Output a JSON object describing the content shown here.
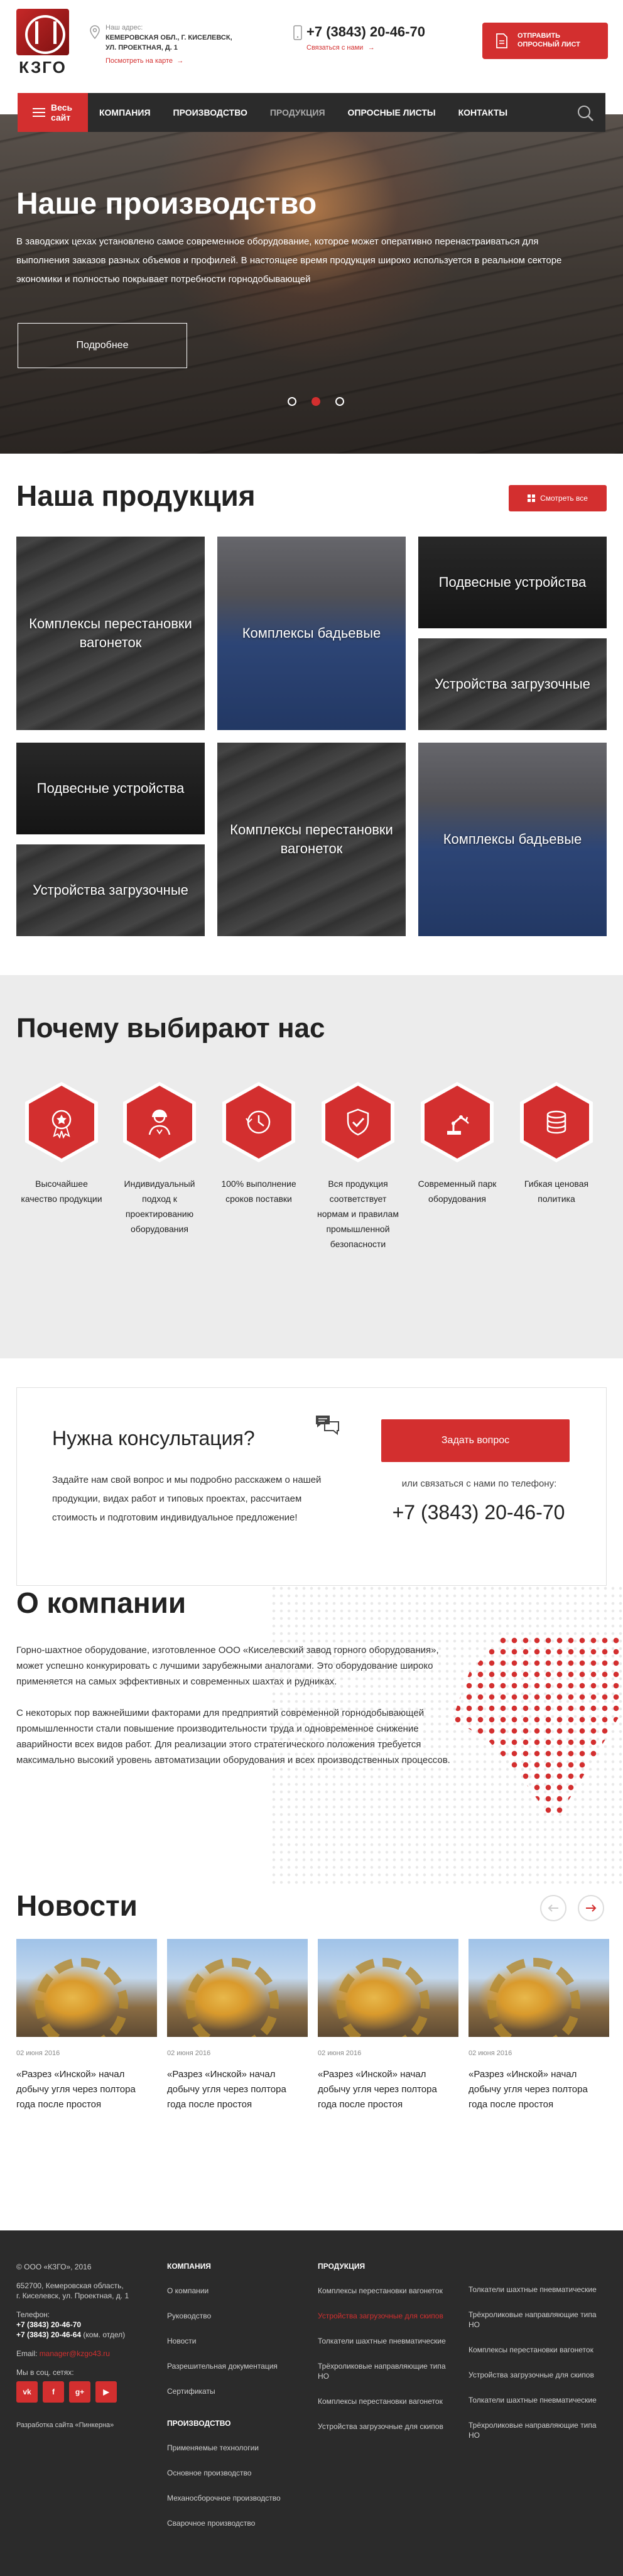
{
  "header": {
    "logo_text": "КЗГО",
    "address_label": "Наш адрес:",
    "address_line1": "Кемеровская обл., г. Киселевск,",
    "address_line2": "ул. Проектная, д. 1",
    "map_link": "Посмотреть на карте",
    "phone": "+7 (3843) 20-46-70",
    "contact_link": "Связаться с нами",
    "survey_btn_line1": "ОТПРАВИТЬ",
    "survey_btn_line2": "ОПРОСНЫЙ ЛИСТ"
  },
  "nav": {
    "all_site": "Весь сайт",
    "items": [
      "Компания",
      "Производство",
      "Продукция",
      "Опросные листы",
      "Контакты"
    ],
    "active": "Продукция"
  },
  "hero": {
    "title": "Наше производство",
    "text": "В заводских цехах установлено самое современное оборудование, которое может оперативно перенастраиваться для выполнения заказов разных объемов и профилей. В настоящее время продукция широко используется в реальном секторе экономики и полностью покрывает потребности горнодобывающей",
    "button": "Подробнее"
  },
  "products": {
    "title": "Наша продукция",
    "view_all": "Смотреть все",
    "tiles": [
      "Комплексы перестановки вагонеток",
      "Комплексы бадьевые",
      "Подвесные устройства",
      "Устройства загрузочные",
      "Подвесные устройства",
      "Комплексы перестановки вагонеток",
      "Комплексы бадьевые",
      "Устройства загрузочные"
    ]
  },
  "why": {
    "title": "Почему выбирают нас",
    "features": [
      {
        "label": "Высочайшее качество продукции",
        "icon": "medal-icon"
      },
      {
        "label": "Индивидуальный подход к проектированию оборудования",
        "icon": "engineer-icon"
      },
      {
        "label": "100% выполнение сроков поставки",
        "icon": "clock-icon"
      },
      {
        "label": "Вся продукция соответствует нормам и правилам промышленной безопасности",
        "icon": "shield-check-icon"
      },
      {
        "label": "Современный парк оборудования",
        "icon": "robot-arm-icon"
      },
      {
        "label": "Гибкая ценовая политика",
        "icon": "coins-icon"
      }
    ]
  },
  "consult": {
    "title": "Нужна консультация?",
    "text": "Задайте нам свой вопрос и мы подробно расскажем о нашей продукции, видах работ и типовых проектах, рассчитаем стоимость и подготовим индивидуальное предложение!",
    "button": "Задать вопрос",
    "call_label": "или связаться с нами по телефону:",
    "phone": "+7 (3843) 20-46-70"
  },
  "about": {
    "title": "О компании",
    "p1": "Горно-шахтное оборудование, изготовленное ООО «Киселевский завод горного оборудования», может успешно конкурировать с лучшими зарубежными аналогами. Это оборудование широко применяется на самых эффективных и современных шахтах и рудниках.",
    "p2": "С некоторых пор важнейшими факторами для предприятий современной горнодобывающей промышленности стали повышение производительности труда и одновременное снижение аварийности всех видов работ. Для реализации этого стратегического положения требуется максимально высокий уровень автоматизации оборудования и всех производственных процессов."
  },
  "news": {
    "title": "Новости",
    "items": [
      {
        "date": "02 июня 2016",
        "title": "«Разрез «Инской» начал добычу угля через полтора года после простоя"
      },
      {
        "date": "02 июня 2016",
        "title": "«Разрез «Инской» начал добычу угля через полтора года после простоя"
      },
      {
        "date": "02 июня 2016",
        "title": "«Разрез «Инской» начал добычу угля через полтора года после простоя"
      },
      {
        "date": "02 июня 2016",
        "title": "«Разрез «Инской» начал добычу угля через полтора года после простоя"
      }
    ]
  },
  "footer": {
    "copyright": "© ООО «КЗГО», 2016",
    "address1": "652700, Кемеровская область,",
    "address2": "г. Киселевск, ул. Проектная, д. 1",
    "phone_label": "Телефон:",
    "phone1": "+7 (3843) 20-46-70",
    "phone2": "+7 (3843) 20-46-64",
    "phone2_note": " (ком. отдел)",
    "email_label": "Email: ",
    "email": "manager@kzgo43.ru",
    "social_label": "Мы в соц. сетях:",
    "social": [
      "vk",
      "f",
      "g+",
      "▶"
    ],
    "developer": "Разработка сайта «Пинкерна»",
    "company_head": "КОМПАНИЯ",
    "company_links": [
      "О компании",
      "Руководство",
      "Новости",
      "Разрешительная документация",
      "Сертификаты"
    ],
    "production_head": "ПРОИЗВОДСТВО",
    "production_links": [
      "Применяемые технологии",
      "Основное производство",
      "Механосборочное производство",
      "Сварочное производство"
    ],
    "products_head": "ПРОДУКЦИЯ",
    "products_col1": [
      "Комплексы перестановки вагонеток",
      "Устройства загрузочные для скипов",
      "Толкатели шахтные пневматические",
      "Трёхроликовые направляющие типа НО",
      "Комплексы перестановки вагонеток",
      "Устройства загрузочные для скипов"
    ],
    "products_col2": [
      "Толкатели шахтные пневматические",
      "Трёхроликовые направляющие типа НО",
      "Комплексы перестановки вагонеток",
      "Устройства загрузочные для скипов",
      "Толкатели шахтные пневматические",
      "Трёхроликовые направляющие типа НО"
    ],
    "active_product": "Устройства загрузочные для скипов"
  }
}
